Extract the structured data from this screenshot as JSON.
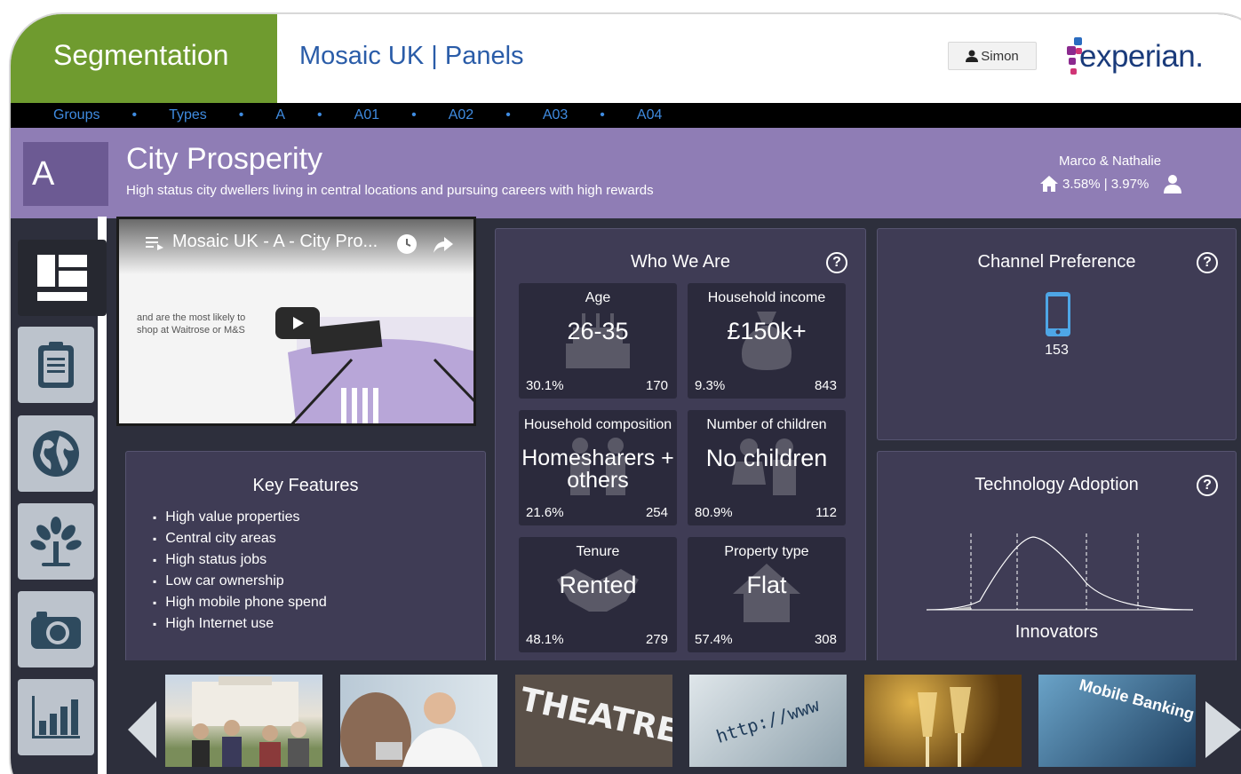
{
  "header": {
    "brand": "Segmentation",
    "app_title": "Mosaic UK | Panels",
    "user_name": "Simon",
    "logo_text": "experian."
  },
  "breadcrumbs": [
    "Groups",
    "Types",
    "A",
    "A01",
    "A02",
    "A03",
    "A04"
  ],
  "banner": {
    "letter": "A",
    "title": "City Prosperity",
    "subtitle": "High status city dwellers living in central locations and pursuing careers with high rewards",
    "rep_name": "Marco & Nathalie",
    "rep_stats": "3.58% | 3.97%"
  },
  "sidebar": {
    "items": [
      {
        "icon": "dashboard-icon",
        "active": true
      },
      {
        "icon": "clipboard-icon",
        "active": false
      },
      {
        "icon": "globe-icon",
        "active": false
      },
      {
        "icon": "tree-icon",
        "active": false
      },
      {
        "icon": "camera-icon",
        "active": false
      },
      {
        "icon": "bar-chart-icon",
        "active": false
      }
    ]
  },
  "video": {
    "title": "Mosaic UK - A - City Pro...",
    "caption": "and are the most likely to shop at Waitrose or M&S"
  },
  "key_features": {
    "title": "Key Features",
    "items": [
      "High value properties",
      "Central city areas",
      "High status jobs",
      "Low car ownership",
      "High mobile phone spend",
      "High Internet use"
    ]
  },
  "who_we_are": {
    "title": "Who We Are",
    "help": "?",
    "tiles": [
      {
        "label": "Age",
        "value": "26-35",
        "pct": "30.1%",
        "index": "170"
      },
      {
        "label": "Household income",
        "value": "£150k+",
        "pct": "9.3%",
        "index": "843"
      },
      {
        "label": "Household composition",
        "value": "Homesharers + others",
        "pct": "21.6%",
        "index": "254"
      },
      {
        "label": "Number of children",
        "value": "No children",
        "pct": "80.9%",
        "index": "112"
      },
      {
        "label": "Tenure",
        "value": "Rented",
        "pct": "48.1%",
        "index": "279"
      },
      {
        "label": "Property type",
        "value": "Flat",
        "pct": "57.4%",
        "index": "308"
      }
    ]
  },
  "channel_preference": {
    "title": "Channel Preference",
    "help": "?",
    "icon": "mobile-phone-icon",
    "value": "153"
  },
  "technology_adoption": {
    "title": "Technology Adoption",
    "help": "?",
    "label": "Innovators"
  },
  "thumbnails": {
    "items": [
      {
        "name": "family-photo",
        "text": ""
      },
      {
        "name": "doctor-photo",
        "text": ""
      },
      {
        "name": "theatre-photo",
        "text": "THEATRE"
      },
      {
        "name": "http-photo",
        "text": "http://www"
      },
      {
        "name": "champagne-photo",
        "text": ""
      },
      {
        "name": "mobile-banking-photo",
        "text": "Mobile Banking"
      }
    ]
  },
  "colors": {
    "brand_green": "#6f9b2f",
    "title_blue": "#2a5ca8",
    "banner_purple": "#8f7db5",
    "panel_bg": "#3f3c55",
    "tile_bg": "#2b2a3c"
  }
}
